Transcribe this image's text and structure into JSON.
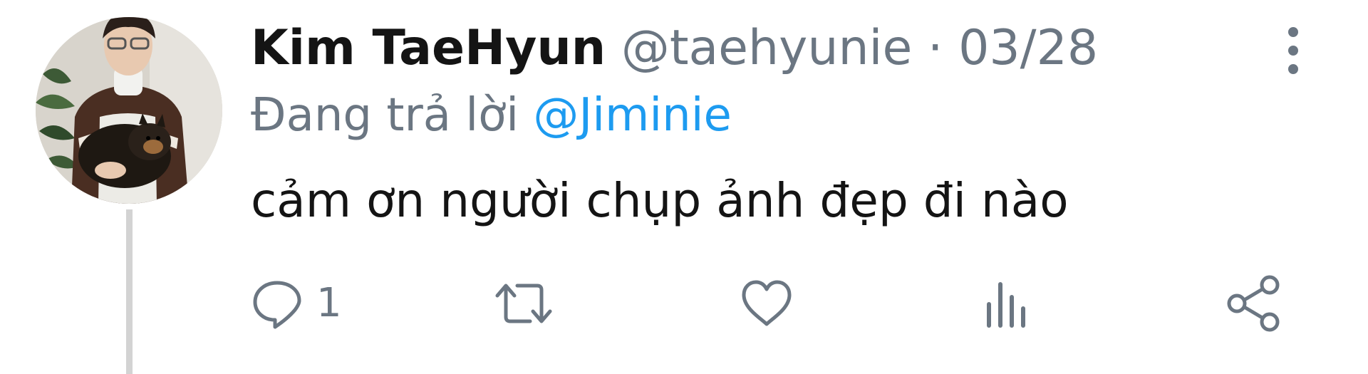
{
  "tweet": {
    "name": "Kim TaeHyun",
    "handle": "@taehyunie",
    "separator": "·",
    "date": "03/28",
    "reply_prefix": "Đang trả lời",
    "reply_to": "@Jiminie",
    "text": "cảm ơn người chụp ảnh đẹp đi nào"
  },
  "actions": {
    "reply_count": "1",
    "icons": [
      "reply-icon",
      "retweet-icon",
      "like-icon",
      "analytics-icon",
      "share-icon"
    ]
  },
  "colors": {
    "text": "#141414",
    "muted": "#6b7682",
    "mention": "#1d9bf0",
    "thread_line": "#d3d3d3"
  }
}
